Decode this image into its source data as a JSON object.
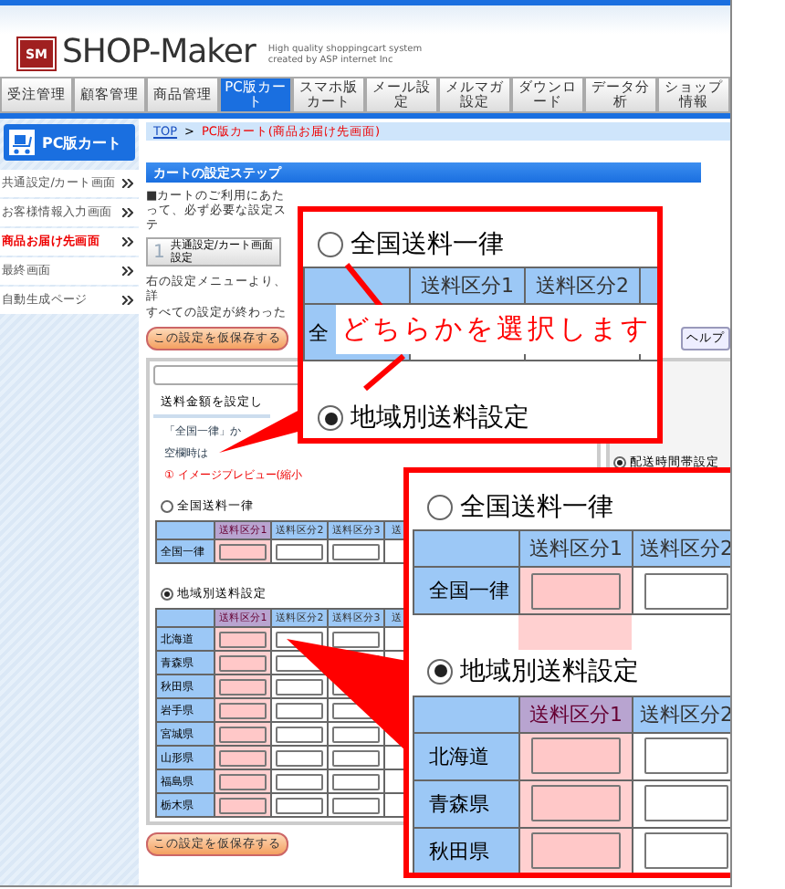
{
  "header": {
    "logo_mark": "SM",
    "logo": "SHOP-Maker",
    "tagline": [
      "High quality shoppingcart system",
      "created by ASP internet Inc"
    ]
  },
  "nav": [
    {
      "label": "受注管理",
      "selected": false
    },
    {
      "label": "顧客管理",
      "selected": false
    },
    {
      "label": "商品管理",
      "selected": false
    },
    {
      "label": "PC版カート",
      "selected": true
    },
    {
      "label": "スマホ版カート",
      "selected": false
    },
    {
      "label": "メール設定",
      "selected": false
    },
    {
      "label": "メルマガ設定",
      "selected": false
    },
    {
      "label": "ダウンロード",
      "selected": false
    },
    {
      "label": "データ分析",
      "selected": false
    },
    {
      "label": "ショップ情報",
      "selected": false
    }
  ],
  "sidebar": {
    "title": "PC版カート",
    "items": [
      {
        "label": "共通設定/カート画面",
        "selected": false
      },
      {
        "label": "お客様情報入力画面",
        "selected": false
      },
      {
        "label": "商品お届け先画面",
        "selected": true
      },
      {
        "label": "最終画面",
        "selected": false
      },
      {
        "label": "自動生成ページ",
        "selected": false
      }
    ]
  },
  "breadcrumb": {
    "home": "TOP",
    "separator": ">",
    "current": "PC版カート(商品お届け先画面)"
  },
  "steps": {
    "title": "カートの設定ステップ",
    "intro": "■カートのご利用にあたって、必ず必要な設定ステ",
    "step_number": "1",
    "step_label": "共通設定/カート画面設定",
    "bullets": [
      "右の設定メニューより、詳",
      "すべての設定が終わった"
    ]
  },
  "save_button": "この設定を仮保存する",
  "help_button": "ヘルプ",
  "side_menu": {
    "item": "配送時間帯設定"
  },
  "form": {
    "heading": "送料金額を設定し",
    "notes": [
      "「全国一律」か",
      "空欄時は"
    ],
    "warning": "① イメージプレビュー(縮小",
    "flat": {
      "label": "全国送料一律",
      "selected": false,
      "rows": [
        "全国一律"
      ],
      "columns": [
        {
          "label": "送料区分1",
          "highlighted": true
        },
        {
          "label": "送料区分2",
          "highlighted": false
        },
        {
          "label": "送料区分3",
          "highlighted": false
        },
        {
          "label": "送",
          "highlighted": false
        }
      ]
    },
    "regional": {
      "label": "地域別送料設定",
      "selected": true,
      "rows": [
        "北海道",
        "青森県",
        "秋田県",
        "岩手県",
        "宮城県",
        "山形県",
        "福島県",
        "栃木県"
      ],
      "columns": [
        {
          "label": "送料区分1",
          "highlighted": true
        },
        {
          "label": "送料区分2",
          "highlighted": false
        },
        {
          "label": "送料区分3",
          "highlighted": false
        },
        {
          "label": "送",
          "highlighted": false
        }
      ]
    }
  },
  "bottom_save_button": "この設定を仮保存する",
  "callout_choice": {
    "options": [
      {
        "label": "全国送料一律",
        "selected": false
      },
      {
        "label": "地域別送料設定",
        "selected": true
      }
    ],
    "columns": [
      "送料区分1",
      "送料区分2"
    ],
    "row_label": "全",
    "note": "どちらかを選択します"
  },
  "callout_detail": {
    "flat": {
      "label": "全国送料一律",
      "selected": false,
      "rows": [
        "全国一律"
      ],
      "columns": [
        {
          "label": "送料区分1",
          "highlighted": true
        },
        {
          "label": "送料区分2",
          "highlighted": false
        }
      ]
    },
    "regional": {
      "label": "地域別送料設定",
      "selected": true,
      "rows": [
        "北海道",
        "青森県",
        "秋田県"
      ],
      "columns": [
        {
          "label": "送料区分1",
          "highlighted": true
        },
        {
          "label": "送料区分2",
          "highlighted": false
        }
      ]
    }
  }
}
